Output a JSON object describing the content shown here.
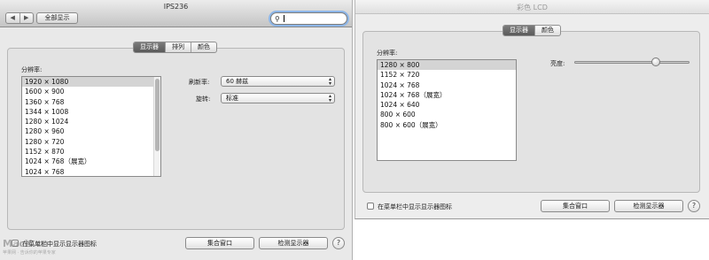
{
  "left": {
    "title": "IPS236",
    "nav": {
      "back": "◀",
      "forward": "▶"
    },
    "show_all": "全部显示",
    "tabs": [
      "显示器",
      "排列",
      "颜色"
    ],
    "resolution_label": "分辨率:",
    "resolutions": [
      "1920 × 1080",
      "1600 × 900",
      "1360 × 768",
      "1344 × 1008",
      "1280 × 1024",
      "1280 × 960",
      "1280 × 720",
      "1152 × 870",
      "1024 × 768（展宽）",
      "1024 × 768"
    ],
    "selected_resolution": 0,
    "refresh_label": "刷新率:",
    "refresh_value": "60 赫兹",
    "rotation_label": "旋转:",
    "rotation_value": "标准",
    "menu_bar_checkbox_label": "在菜单栏中显示显示器图标",
    "gather_windows": "集合窗口",
    "detect_displays": "检测显示器",
    "help": "?",
    "watermark": "MacX.cn",
    "watermark_sub": "苹果网 · 告诉你的苹果专家"
  },
  "right": {
    "title": "彩色 LCD",
    "tabs": [
      "显示器",
      "颜色"
    ],
    "resolution_label": "分辨率:",
    "resolutions": [
      "1280 × 800",
      "1152 × 720",
      "1024 × 768",
      "1024 × 768（展宽）",
      "1024 × 640",
      "800 × 600",
      "800 × 600（展宽）"
    ],
    "selected_resolution": 0,
    "brightness_label": "亮度:",
    "brightness_level": 0.71,
    "menu_bar_checkbox_label": "在菜单栏中显示显示器图标",
    "gather_windows": "集合窗口",
    "detect_displays": "检测显示器",
    "help": "?"
  }
}
